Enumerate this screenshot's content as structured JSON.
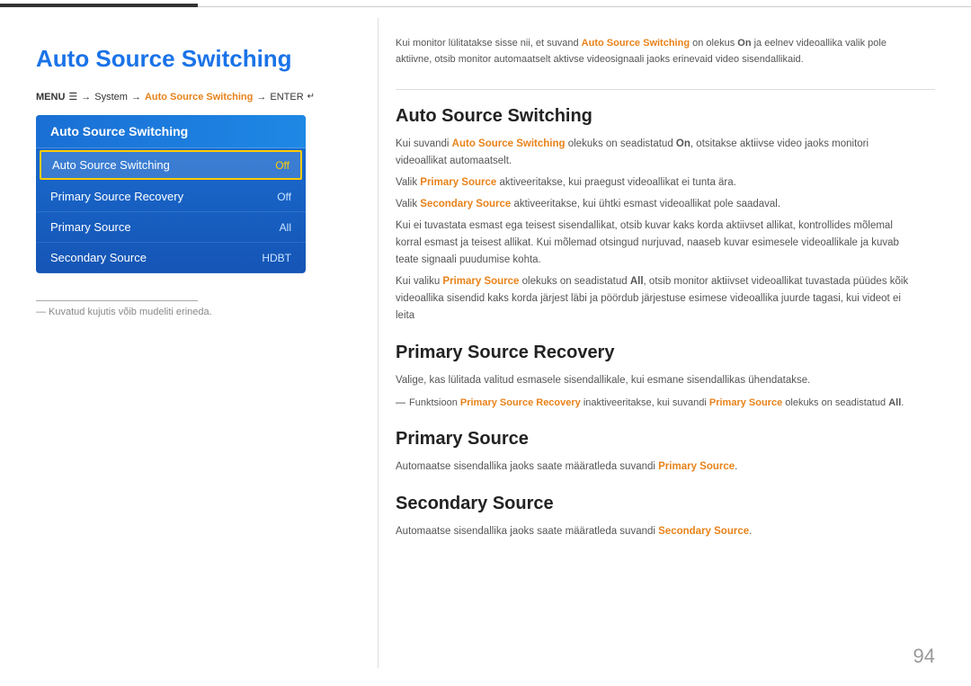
{
  "topBar": {
    "label": "top-bar"
  },
  "leftPanel": {
    "pageTitle": "Auto Source Switching",
    "menuPath": {
      "menu": "MENU",
      "menuIcon": "☰",
      "arrow1": "→",
      "system": "System",
      "arrow2": "→",
      "highlight": "Auto Source Switching",
      "arrow3": "→",
      "enter": "ENTER",
      "enterIcon": "↵"
    },
    "menuBox": {
      "header": "Auto Source Switching",
      "items": [
        {
          "label": "Auto Source Switching",
          "value": "Off",
          "active": true
        },
        {
          "label": "Primary Source Recovery",
          "value": "Off",
          "active": false
        },
        {
          "label": "Primary Source",
          "value": "All",
          "active": false
        },
        {
          "label": "Secondary Source",
          "value": "HDBT",
          "active": false
        }
      ]
    },
    "footnoteLine": true,
    "footnoteText": "— Kuvatud kujutis võib mudeliti erineda."
  },
  "rightPanel": {
    "introText": "Kui monitor lülitatakse sisse nii, et suvand Auto Source Switching on olekus On ja eelnev videoallika valik pole aktiivne, otsib monitor automaatselt aktivse videosignaali jaoks erinevaid video sisendallikaid.",
    "sections": [
      {
        "id": "auto-source-switching",
        "title": "Auto Source Switching",
        "paragraphs": [
          "Kui suvandi Auto Source Switching olekuks on seadistatud On, otsitakse aktiivse video jaoks monitori videoallikat automaatselt.",
          "Valik Primary Source aktiveeritakse, kui praegust videoallikat ei tunta ära.",
          "Valik Secondary Source aktiveeritakse, kui ühtki esmast videoallikat pole saadaval.",
          "Kui ei tuvastata esmast ega teisest sisendallikat, otsib kuvar kaks korda aktiivset allikat, kontrollides mõlemal korral esmast ja teisest allikat. Kui mõlemad otsingud nurjuvad, naaseb kuvar esimesele videoallikale ja kuvab teate signaali puudumise kohta.",
          "Kui valiku Primary Source olekuks on seadistatud All, otsib monitor aktiivset videoallikat tuvastada püüdes kõik videoallika sisendid kaks korda järjest läbi ja pöördub järjestuse esimese videoallika juurde tagasi, kui videot ei leita"
        ]
      },
      {
        "id": "primary-source-recovery",
        "title": "Primary Source Recovery",
        "paragraphs": [
          "Valige, kas lülitada valitud esmasele sisendallikale, kui esmane sisendallikas ühendatakse."
        ],
        "note": "— Funktsioon Primary Source Recovery inaktiveeritakse, kui suvandi Primary Source olekuks on seadistatud All."
      },
      {
        "id": "primary-source",
        "title": "Primary Source",
        "paragraphs": [
          "Automaatse sisendallika jaoks saate määratleda suvandi Primary Source."
        ]
      },
      {
        "id": "secondary-source",
        "title": "Secondary Source",
        "paragraphs": [
          "Automaatse sisendallika jaoks saate määratleda suvandi Secondary Source."
        ]
      }
    ]
  },
  "pageNumber": "94"
}
